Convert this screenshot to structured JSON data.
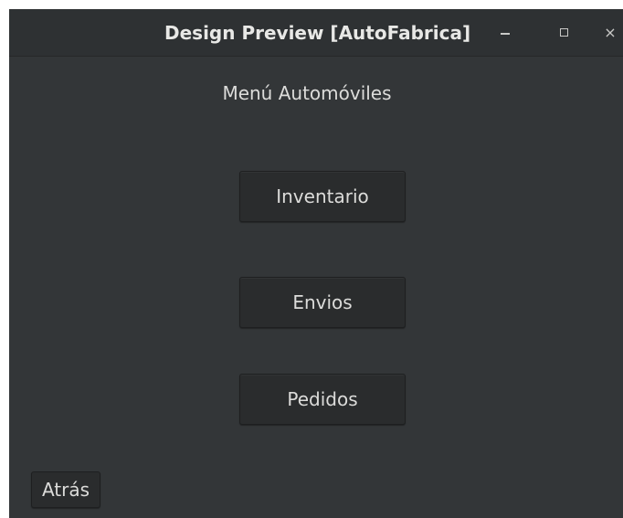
{
  "window": {
    "title": "Design Preview [AutoFabrica]",
    "controls": {
      "minimize_icon": "minimize-icon",
      "maximize_icon": "maximize-icon",
      "close_icon": "close-icon",
      "close_glyph": "×"
    }
  },
  "main": {
    "heading": "Menú Automóviles",
    "buttons": [
      {
        "label": "Inventario"
      },
      {
        "label": "Envios"
      },
      {
        "label": "Pedidos"
      }
    ],
    "back_label": "Atrás"
  },
  "colors": {
    "window_bg": "#333638",
    "titlebar_bg": "#2e3133",
    "button_bg": "#2a2c2d",
    "text": "#dcdcda"
  }
}
